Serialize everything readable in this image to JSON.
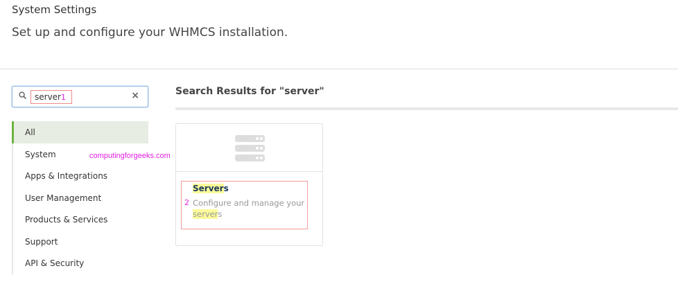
{
  "header": {
    "title": "System Settings",
    "subtitle": "Set up and configure your WHMCS installation."
  },
  "search": {
    "value": "server",
    "annotation": "1",
    "clear_icon": "×"
  },
  "nav": {
    "items": [
      "All",
      "System",
      "Apps & Integrations",
      "User Management",
      "Products & Services",
      "Support",
      "API & Security"
    ]
  },
  "watermark": "computingforgeeks.com",
  "results": {
    "heading": "Search Results for \"server\"",
    "cards": [
      {
        "name_match": "Server",
        "name_rest": "s",
        "desc_line1": "Configure and manage your",
        "desc_match": "server",
        "desc_rest": "s",
        "annotation": "2",
        "icon": "server-stack-icon"
      }
    ]
  }
}
